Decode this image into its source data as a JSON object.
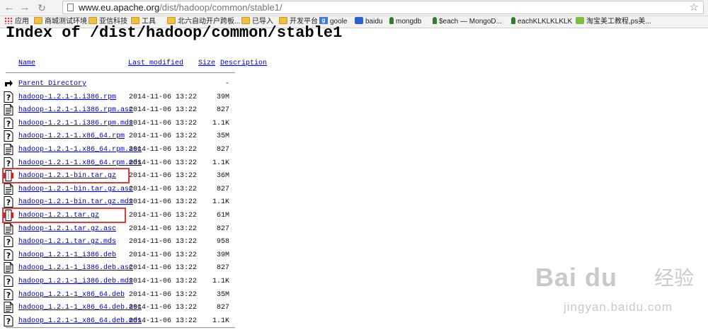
{
  "browser": {
    "url_host": "www.eu.apache.org",
    "url_path": "/dist/hadoop/common/stable1/",
    "bookmarks": [
      {
        "label": "应用",
        "icon": "apps-grid-icon"
      },
      {
        "label": "商城测试环境",
        "icon": "folder-icon"
      },
      {
        "label": "亚信科技",
        "icon": "folder-icon"
      },
      {
        "label": "工具",
        "icon": "folder-icon"
      },
      {
        "label": "北六自动开户跨板...",
        "icon": "folder-icon"
      },
      {
        "label": "已导入",
        "icon": "folder-icon"
      },
      {
        "label": "开发平台",
        "icon": "folder-icon"
      },
      {
        "label": "goole",
        "icon": "google-icon"
      },
      {
        "label": "baidu",
        "icon": "baidu-paw-icon"
      },
      {
        "label": "mongdb",
        "icon": "mongodb-leaf-icon"
      },
      {
        "label": "$each — MongoD...",
        "icon": "mongodb-leaf-icon"
      },
      {
        "label": "eachKLKLKLKLK",
        "icon": "mongodb-leaf-icon"
      },
      {
        "label": "淘宝美工教程,ps美...",
        "icon": "taobao-icon"
      }
    ]
  },
  "page": {
    "heading": "Index of /dist/hadoop/common/stable1",
    "columns": {
      "name": "Name",
      "modified": "Last modified",
      "size": "Size",
      "description": "Description"
    },
    "parent": {
      "name": "Parent Directory",
      "size": "-"
    },
    "files": [
      {
        "name": "hadoop-1.2.1-1.i386.rpm",
        "modified": "2014-11-06 13:22",
        "size": "39M",
        "icon": "unknown-file-icon"
      },
      {
        "name": "hadoop-1.2.1-1.i386.rpm.asc",
        "modified": "2014-11-06 13:22",
        "size": "827",
        "icon": "text-file-icon"
      },
      {
        "name": "hadoop-1.2.1-1.i386.rpm.mds",
        "modified": "2014-11-06 13:22",
        "size": "1.1K",
        "icon": "unknown-file-icon"
      },
      {
        "name": "hadoop-1.2.1-1.x86_64.rpm",
        "modified": "2014-11-06 13:22",
        "size": "35M",
        "icon": "unknown-file-icon"
      },
      {
        "name": "hadoop-1.2.1-1.x86_64.rpm.asc",
        "modified": "2014-11-06 13:22",
        "size": "827",
        "icon": "text-file-icon"
      },
      {
        "name": "hadoop-1.2.1-1.x86_64.rpm.mds",
        "modified": "2014-11-06 13:22",
        "size": "1.1K",
        "icon": "unknown-file-icon"
      },
      {
        "name": "hadoop-1.2.1-bin.tar.gz",
        "modified": "2014-11-06 13:22",
        "size": "36M",
        "icon": "compressed-file-icon"
      },
      {
        "name": "hadoop-1.2.1-bin.tar.gz.asc",
        "modified": "2014-11-06 13:22",
        "size": "827",
        "icon": "text-file-icon"
      },
      {
        "name": "hadoop-1.2.1-bin.tar.gz.mds",
        "modified": "2014-11-06 13:22",
        "size": "1.1K",
        "icon": "unknown-file-icon"
      },
      {
        "name": "hadoop-1.2.1.tar.gz",
        "modified": "2014-11-06 13:22",
        "size": "61M",
        "icon": "compressed-file-icon"
      },
      {
        "name": "hadoop-1.2.1.tar.gz.asc",
        "modified": "2014-11-06 13:22",
        "size": "827",
        "icon": "text-file-icon"
      },
      {
        "name": "hadoop-1.2.1.tar.gz.mds",
        "modified": "2014-11-06 13:22",
        "size": "958",
        "icon": "unknown-file-icon"
      },
      {
        "name": "hadoop_1.2.1-1_i386.deb",
        "modified": "2014-11-06 13:22",
        "size": "39M",
        "icon": "unknown-file-icon"
      },
      {
        "name": "hadoop_1.2.1-1_i386.deb.asc",
        "modified": "2014-11-06 13:22",
        "size": "827",
        "icon": "text-file-icon"
      },
      {
        "name": "hadoop_1.2.1-1_i386.deb.mds",
        "modified": "2014-11-06 13:22",
        "size": "1.1K",
        "icon": "unknown-file-icon"
      },
      {
        "name": "hadoop_1.2.1-1_x86_64.deb",
        "modified": "2014-11-06 13:22",
        "size": "35M",
        "icon": "unknown-file-icon"
      },
      {
        "name": "hadoop_1.2.1-1_x86_64.deb.asc",
        "modified": "2014-11-06 13:22",
        "size": "827",
        "icon": "text-file-icon"
      },
      {
        "name": "hadoop_1.2.1-1_x86_64.deb.mds",
        "modified": "2014-11-06 13:22",
        "size": "1.1K",
        "icon": "unknown-file-icon"
      }
    ],
    "highlighted_files": [
      "hadoop-1.2.1-bin.tar.gz",
      "hadoop-1.2.1.tar.gz"
    ],
    "highlight_color": "#e03a3a",
    "link_color": "#0000cc"
  },
  "watermark": {
    "logo_text": "Bai du",
    "cn_text": "经验",
    "url": "jingyan.baidu.com"
  }
}
